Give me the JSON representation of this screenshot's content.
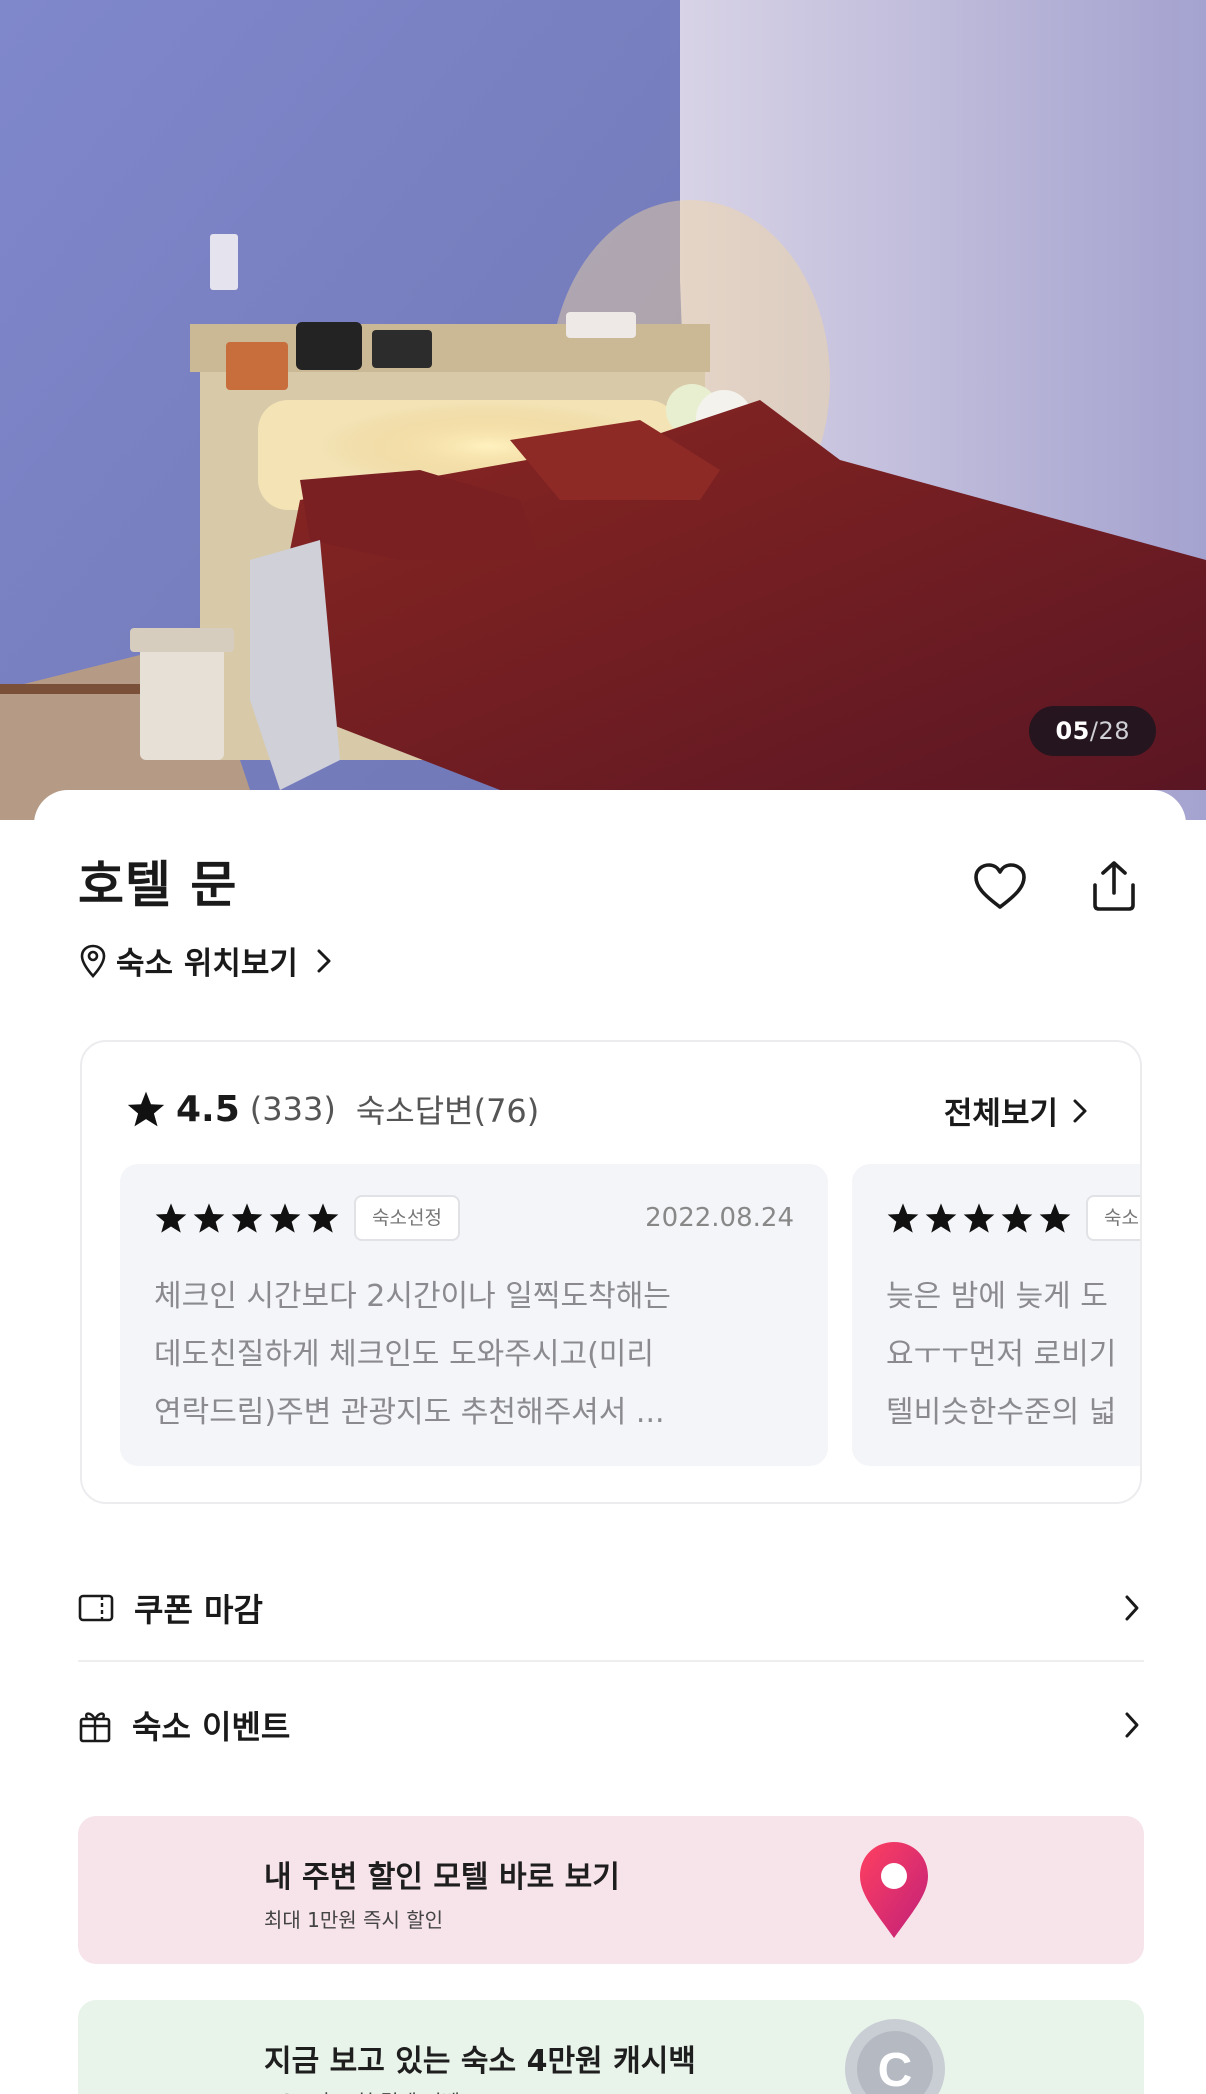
{
  "hero": {
    "counter_current": "05",
    "counter_total": "/28"
  },
  "header": {
    "title": "호텔 문",
    "location_link": "숙소 위치보기",
    "icons": [
      "heart-icon",
      "share-icon"
    ]
  },
  "reviews": {
    "rating": "4.5",
    "count": "(333)",
    "reply": "숙소답변(76)",
    "see_all": "전체보기",
    "items": [
      {
        "stars": 5,
        "tag": "숙소선정",
        "date": "2022.08.24",
        "lines": [
          "체크인 시간보다 2시간이나 일찍도착해는",
          "데도친질하게 체크인도 도와주시고(미리",
          "연락드림)주변 관광지도 추천해주셔서 ..."
        ]
      },
      {
        "stars": 5,
        "tag": "숙소",
        "date": "",
        "lines": [
          "늦은 밤에 늦게 도",
          "요ㅜㅜ먼저 로비기",
          "텔비슷한수준의 넓"
        ]
      }
    ]
  },
  "menu": {
    "coupon": "쿠폰 마감",
    "event": "숙소 이벤트"
  },
  "banners": {
    "nearby_title": "내 주변 할인 모텔 바로 보기",
    "nearby_sub": "최대 1만원 즉시 할인",
    "cashback_title": "지금 보고 있는 숙소 4만원 캐시백",
    "cashback_sub": "NOL 카드 첫 결제 이벤트"
  },
  "colors": {
    "pink_banner": "#f7e4ea",
    "green_banner": "#e8f3ea",
    "pin": "#e8305f"
  }
}
